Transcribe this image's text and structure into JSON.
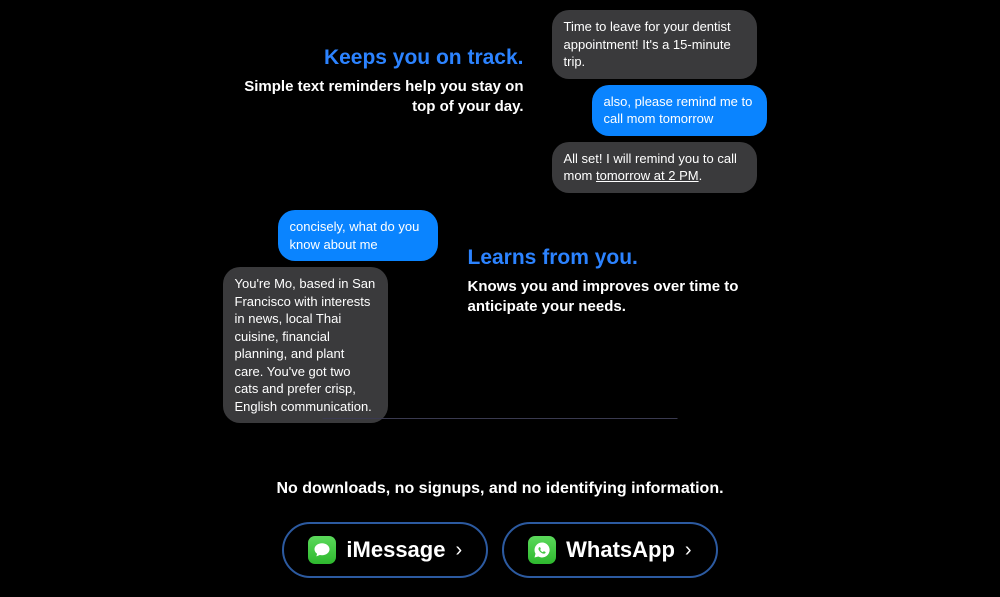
{
  "section1": {
    "headline": "Keeps you on track.",
    "subhead": "Simple text reminders help you stay on top of your day.",
    "messages": [
      {
        "side": "gray",
        "text": "Time to leave for your dentist appointment! It's a 15-minute trip."
      },
      {
        "side": "blue",
        "text": "also, please remind me to call mom tomorrow"
      },
      {
        "side": "gray",
        "text_pre": "All set! I will remind you to call mom ",
        "text_underline": "tomorrow at 2 PM",
        "text_post": "."
      }
    ]
  },
  "section2": {
    "headline": "Learns from you.",
    "subhead": "Knows you and improves over time to anticipate your needs.",
    "messages": [
      {
        "side": "blue",
        "text": "concisely, what do you know about me"
      },
      {
        "side": "gray",
        "text": "You're Mo, based in San Francisco with interests in news, local Thai cuisine, financial planning, and plant care. You've got two cats and prefer crisp, English communication."
      }
    ]
  },
  "cta": {
    "tagline": "No downloads, no signups, and no identifying information.",
    "buttons": [
      {
        "icon": "imessage",
        "label": "iMessage"
      },
      {
        "icon": "whatsapp",
        "label": "WhatsApp"
      }
    ],
    "chevron": "›"
  }
}
